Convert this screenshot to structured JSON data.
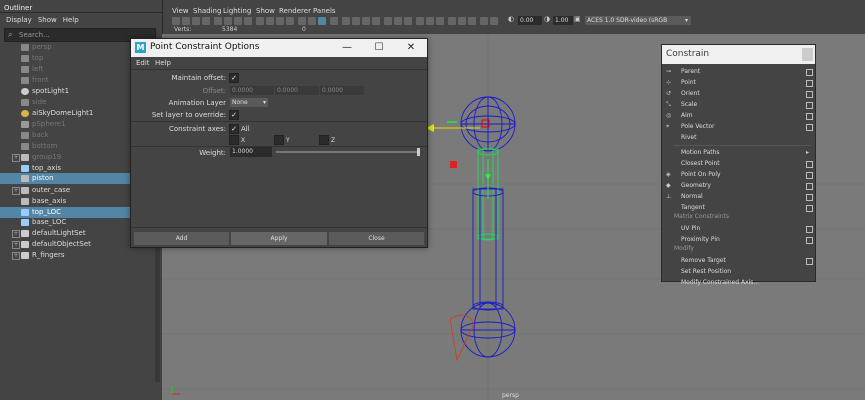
{
  "outliner": {
    "title": "Outliner",
    "menu": [
      "Display",
      "Show",
      "Help"
    ],
    "search_placeholder": "Search...",
    "items": [
      {
        "label": "persp",
        "dim": true,
        "icon": "camera-icon"
      },
      {
        "label": "top",
        "dim": true,
        "icon": "camera-icon"
      },
      {
        "label": "left",
        "dim": true,
        "icon": "camera-icon"
      },
      {
        "label": "front",
        "dim": true,
        "icon": "camera-icon"
      },
      {
        "label": "spotLight1",
        "dim": false,
        "icon": "spotlight-icon"
      },
      {
        "label": "side",
        "dim": true,
        "icon": "camera-icon"
      },
      {
        "label": "aiSkyDomeLight1",
        "dim": false,
        "icon": "skydome-light-icon"
      },
      {
        "label": "pSphere1",
        "dim": true,
        "icon": "mesh-icon"
      },
      {
        "label": "back",
        "dim": true,
        "icon": "camera-icon"
      },
      {
        "label": "bottom",
        "dim": true,
        "icon": "camera-icon"
      },
      {
        "label": "group19",
        "dim": true,
        "icon": "group-icon"
      },
      {
        "label": "top_axis",
        "dim": false,
        "icon": "locator-icon"
      },
      {
        "label": "piston",
        "dim": false,
        "icon": "group-icon",
        "selected": true
      },
      {
        "label": "outer_case",
        "dim": false,
        "icon": "group-icon"
      },
      {
        "label": "base_axis",
        "dim": false,
        "icon": "group-icon"
      },
      {
        "label": "top_LOC",
        "dim": false,
        "icon": "locator-icon",
        "selected": true
      },
      {
        "label": "base_LOC",
        "dim": false,
        "icon": "locator-icon"
      },
      {
        "label": "defaultLightSet",
        "dim": false,
        "icon": "set-icon"
      },
      {
        "label": "defaultObjectSet",
        "dim": false,
        "icon": "set-icon"
      },
      {
        "label": "R_fingers",
        "dim": false,
        "icon": "set-icon"
      }
    ]
  },
  "viewport": {
    "menu": [
      "View",
      "Shading",
      "Lighting",
      "Show",
      "Renderer",
      "Panels"
    ],
    "hud_label": "Verts:",
    "hud_value1": "5384",
    "hud_value2": "0",
    "exposure": "0.00",
    "gamma": "1.00",
    "colorspace": "ACES 1.0 SDR-video (sRGB",
    "camera_label": "persp"
  },
  "dialog": {
    "title": "Point Constraint Options",
    "menu": [
      "Edit",
      "Help"
    ],
    "maintain_offset_label": "Maintain offset:",
    "offset_label": "Offset:",
    "offset_values": [
      "0.0000",
      "0.0000",
      "0.0000"
    ],
    "animation_layer_label": "Animation Layer",
    "animation_layer_value": "None",
    "set_layer_label": "Set layer to override:",
    "constraint_axes_label": "Constraint axes:",
    "all_label": "All",
    "x_label": "X",
    "y_label": "Y",
    "z_label": "Z",
    "weight_label": "Weight:",
    "weight_value": "1.0000",
    "weight_fraction": 1.0,
    "buttons": {
      "add": "Add",
      "apply": "Apply",
      "close": "Close"
    }
  },
  "constrain_menu": {
    "title": "Constrain",
    "items": [
      {
        "label": "Parent",
        "icon": "parent-constraint-icon"
      },
      {
        "label": "Point",
        "icon": "point-constraint-icon"
      },
      {
        "label": "Orient",
        "icon": "orient-constraint-icon"
      },
      {
        "label": "Scale",
        "icon": "scale-constraint-icon"
      },
      {
        "label": "Aim",
        "icon": "aim-constraint-icon"
      },
      {
        "label": "Pole Vector",
        "icon": "pole-vector-icon"
      },
      {
        "label": "Rivet",
        "icon": ""
      }
    ],
    "items2": [
      {
        "label": "Motion Paths",
        "submenu": true
      },
      {
        "label": "Closest Point"
      },
      {
        "label": "Point On Poly",
        "icon": "point-on-poly-icon"
      },
      {
        "label": "Geometry",
        "icon": "geometry-constraint-icon"
      },
      {
        "label": "Normal",
        "icon": "normal-constraint-icon"
      },
      {
        "label": "Tangent"
      }
    ],
    "section_matrix": "Matrix Constraints",
    "items3": [
      {
        "label": "UV Pin"
      },
      {
        "label": "Proximity Pin"
      }
    ],
    "section_modify": "Modify",
    "items4": [
      {
        "label": "Remove Target"
      },
      {
        "label": "Set Rest Position"
      },
      {
        "label": "Modify Constrained Axis..."
      }
    ]
  }
}
